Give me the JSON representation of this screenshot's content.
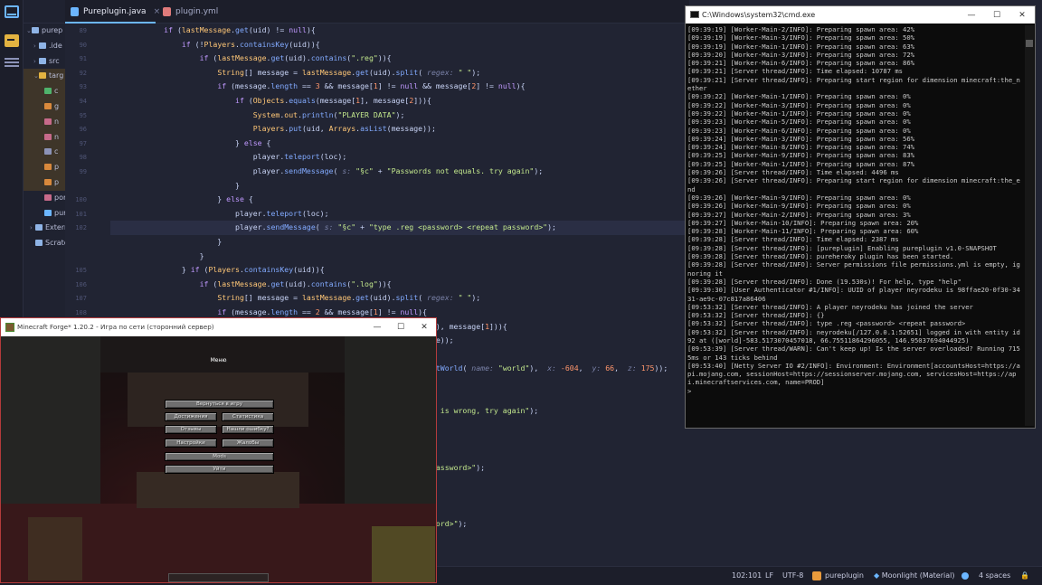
{
  "ide": {
    "tabs": [
      {
        "label": "Pureplugin.java",
        "active": true
      },
      {
        "label": "plugin.yml",
        "active": false
      }
    ],
    "tree": [
      {
        "label": "purep",
        "chev": "⌄"
      },
      {
        "label": ".ide",
        "chev": "›"
      },
      {
        "label": "src",
        "chev": "›"
      },
      {
        "label": "targ",
        "chev": "⌄"
      },
      {
        "label": "c",
        "chev": ""
      },
      {
        "label": "g",
        "chev": ""
      },
      {
        "label": "n",
        "chev": ""
      },
      {
        "label": "n",
        "chev": ""
      },
      {
        "label": "c",
        "chev": ""
      },
      {
        "label": "p",
        "chev": ""
      },
      {
        "label": "p",
        "chev": ""
      },
      {
        "label": "por",
        "chev": ""
      },
      {
        "label": "pur",
        "chev": ""
      },
      {
        "label": "Extern",
        "chev": "›"
      },
      {
        "label": "Scratc",
        "chev": ""
      }
    ],
    "code": [
      {
        "n": "89",
        "html": "            <span class=\"k\">if</span> (<span class=\"t\">lastMessage</span>.<span class=\"f\">get</span>(uid) != <span class=\"k\">null</span>){"
      },
      {
        "n": "90",
        "html": "                <span class=\"k\">if</span> (!<span class=\"t\">Players</span>.<span class=\"f\">containsKey</span>(uid)){"
      },
      {
        "n": "91",
        "html": "                    <span class=\"k\">if</span> (<span class=\"t\">lastMessage</span>.<span class=\"f\">get</span>(uid).<span class=\"f\">contains</span>(<span class=\"s\">\".reg\"</span>)){"
      },
      {
        "n": "92",
        "html": "                        <span class=\"t\">String</span>[] message = <span class=\"t\">lastMessage</span>.<span class=\"f\">get</span>(uid).<span class=\"f\">split</span>( <span class=\"h\">regex:</span> <span class=\"s\">\" \"</span>);"
      },
      {
        "n": "93",
        "html": "                        <span class=\"k\">if</span> (message.<span class=\"f\">length</span> == <span class=\"c\">3</span> &amp;&amp; message[<span class=\"c\">1</span>] != <span class=\"k\">null</span> &amp;&amp; message[<span class=\"c\">2</span>] != <span class=\"k\">null</span>){"
      },
      {
        "n": "94",
        "html": "                            <span class=\"k\">if</span> (<span class=\"t\">Objects</span>.<span class=\"f\">equals</span>(message[<span class=\"c\">1</span>], message[<span class=\"c\">2</span>])){"
      },
      {
        "n": "95",
        "html": "                                <span class=\"t\">System</span>.<span class=\"t\">out</span>.<span class=\"f\">println</span>(<span class=\"s\">\"PLAYER DATA\"</span>);"
      },
      {
        "n": "96",
        "html": "                                <span class=\"t\">Players</span>.<span class=\"f\">put</span>(uid, <span class=\"t\">Arrays</span>.<span class=\"f\">asList</span>(message));"
      },
      {
        "n": "97",
        "html": "                            } <span class=\"k\">else</span> {"
      },
      {
        "n": "98",
        "html": "                                player.<span class=\"f\">teleport</span>(loc);"
      },
      {
        "n": "99",
        "html": "                                player.<span class=\"f\">sendMessage</span>( <span class=\"h\">s:</span> <span class=\"s\">\"§c\"</span> + <span class=\"s\">\"Passwords not equals. try again\"</span>);"
      },
      {
        "n": "",
        "html": "                            }"
      },
      {
        "n": "100",
        "html": "                        } <span class=\"k\">else</span> {"
      },
      {
        "n": "101",
        "html": "                            player.<span class=\"f\">teleport</span>(loc);"
      },
      {
        "n": "102",
        "html": "                            player.<span class=\"f\">sendMessage</span>( <span class=\"h\">s:</span> <span class=\"s\">\"§c\"</span> + <span class=\"s\">\"type .reg &lt;password&gt; &lt;repeat password&gt;\"</span>);",
        "hl": true
      },
      {
        "n": "",
        "html": "                        }"
      },
      {
        "n": "",
        "html": "                    }"
      },
      {
        "n": "105",
        "html": "                } <span class=\"k\">if</span> (<span class=\"t\">Players</span>.<span class=\"f\">containsKey</span>(uid)){"
      },
      {
        "n": "106",
        "html": "                    <span class=\"k\">if</span> (<span class=\"t\">lastMessage</span>.<span class=\"f\">get</span>(uid).<span class=\"f\">contains</span>(<span class=\"s\">\".log\"</span>)){"
      },
      {
        "n": "107",
        "html": "                        <span class=\"t\">String</span>[] message = <span class=\"t\">lastMessage</span>.<span class=\"f\">get</span>(uid).<span class=\"f\">split</span>( <span class=\"h\">regex:</span> <span class=\"s\">\" \"</span>);"
      },
      {
        "n": "108",
        "html": "                        <span class=\"k\">if</span> (message.<span class=\"f\">length</span> == <span class=\"c\">2</span> &amp;&amp; message[<span class=\"c\">1</span>] != <span class=\"k\">null</span>){"
      },
      {
        "n": "",
        "html": "                                                                         ), message[<span class=\"c\">1</span>])){"
      },
      {
        "n": "",
        "html": "                                                                         e));"
      },
      {
        "n": "",
        "html": ""
      },
      {
        "n": "",
        "html": "                                                                        <span class=\"f\">etWorld</span>( <span class=\"h\">name:</span> <span class=\"s\">\"world\"</span>),  <span class=\"h\">x:</span> <span class=\"c\">-604</span>,  <span class=\"h\">y:</span> <span class=\"c\">66</span>,  <span class=\"h\">z:</span> <span class=\"c\">175</span>));"
      },
      {
        "n": "",
        "html": ""
      },
      {
        "n": "",
        "html": ""
      },
      {
        "n": "",
        "html": "                                                                        <span class=\"s\">d is wrong, try again\"</span>);"
      },
      {
        "n": "",
        "html": ""
      },
      {
        "n": "",
        "html": ""
      },
      {
        "n": "",
        "html": ""
      },
      {
        "n": "",
        "html": "                                                                        <span class=\"s\">password&gt;\"</span>);"
      },
      {
        "n": "",
        "html": ""
      },
      {
        "n": "",
        "html": ""
      },
      {
        "n": "",
        "html": ""
      },
      {
        "n": "",
        "html": "                                                                        <span class=\"s\">word&gt;\"</span>);"
      }
    ],
    "status": {
      "position": "102:101",
      "line_sep": "LF",
      "encoding": "UTF-8",
      "project": "pureplugin",
      "theme": "Moonlight (Material)",
      "indent": "4 spaces"
    }
  },
  "cmd": {
    "title": "C:\\Windows\\system32\\cmd.exe",
    "controls": [
      "—",
      "☐",
      "✕"
    ],
    "lines": [
      "[09:39:19] [Worker-Main-2/INFO]: Preparing spawn area: 42%",
      "[09:39:19] [Worker-Main-3/INFO]: Preparing spawn area: 50%",
      "[09:39:19] [Worker-Main-1/INFO]: Preparing spawn area: 63%",
      "[09:39:20] [Worker-Main-3/INFO]: Preparing spawn area: 72%",
      "[09:39:21] [Worker-Main-6/INFO]: Preparing spawn area: 86%",
      "[09:39:21] [Server thread/INFO]: Time elapsed: 10787 ms",
      "[09:39:21] [Server thread/INFO]: Preparing start region for dimension minecraft:the_nether",
      "[09:39:22] [Worker-Main-1/INFO]: Preparing spawn area: 0%",
      "[09:39:22] [Worker-Main-3/INFO]: Preparing spawn area: 0%",
      "[09:39:22] [Worker-Main-1/INFO]: Preparing spawn area: 0%",
      "[09:39:23] [Worker-Main-5/INFO]: Preparing spawn area: 0%",
      "[09:39:23] [Worker-Main-6/INFO]: Preparing spawn area: 0%",
      "[09:39:24] [Worker-Main-3/INFO]: Preparing spawn area: 56%",
      "[09:39:24] [Worker-Main-8/INFO]: Preparing spawn area: 74%",
      "[09:39:25] [Worker-Main-9/INFO]: Preparing spawn area: 83%",
      "[09:39:25] [Worker-Main-1/INFO]: Preparing spawn area: 87%",
      "[09:39:26] [Server thread/INFO]: Time elapsed: 4496 ms",
      "[09:39:26] [Server thread/INFO]: Preparing start region for dimension minecraft:the_end",
      "[09:39:26] [Worker-Main-9/INFO]: Preparing spawn area: 0%",
      "[09:39:26] [Worker-Main-9/INFO]: Preparing spawn area: 0%",
      "[09:39:27] [Worker-Main-2/INFO]: Preparing spawn area: 3%",
      "[09:39:27] [Worker-Main-10/INFO]: Preparing spawn area: 20%",
      "[09:39:28] [Worker-Main-11/INFO]: Preparing spawn area: 60%",
      "[09:39:28] [Server thread/INFO]: Time elapsed: 2387 ms",
      "[09:39:28] [Server thread/INFO]: [pureplugin] Enabling pureplugin v1.0-SNAPSHOT",
      "[09:39:28] [Server thread/INFO]: pureheroky plugin has been started.",
      "[09:39:28] [Server thread/INFO]: Server permissions file permissions.yml is empty, ignoring it",
      "[09:39:28] [Server thread/INFO]: Done (19.530s)! For help, type \"help\"",
      "[09:39:30] [User Authenticator #1/INFO]: UUID of player neyrodeku is 98ffae20-0f30-3431-ae9c-07c817a86406",
      "[09:53:32] [Server thread/INFO]: A player neyrodeku has joined the server",
      "[09:53:32] [Server thread/INFO]: {}",
      "[09:53:32] [Server thread/INFO]: type .reg <password> <repeat password>",
      "[09:53:32] [Server thread/INFO]: neyrodeku[/127.0.0.1:52651] logged in with entity id 92 at ([world]-583.5173070457018, 66.75511864296055, 146.95037694044925)",
      "[09:53:39] [Server thread/WARN]: Can't keep up! Is the server overloaded? Running 7155ms or 143 ticks behind",
      "[09:53:40] [Netty Server IO #2/INFO]: Environment: Environment[accountsHost=https://api.mojang.com, sessionHost=https://sessionserver.mojang.com, servicesHost=https://api.minecraftservices.com, name=PROD]",
      ">"
    ]
  },
  "minecraft": {
    "title": "Minecraft Forge* 1.20.2 - Игра по сети (сторонний сервер)",
    "pause_title": "Меню",
    "buttons": {
      "back": "Вернуться в игру",
      "advancements": "Достижения",
      "statistics": "Статистика",
      "feedback": "Отзывы",
      "report_bugs": "Нашли ошибку?",
      "options": "Настройки",
      "player_reporting": "Жалобы",
      "mods": "Mods",
      "disconnect": "Уйти"
    },
    "controls": [
      "—",
      "☐",
      "✕"
    ]
  }
}
